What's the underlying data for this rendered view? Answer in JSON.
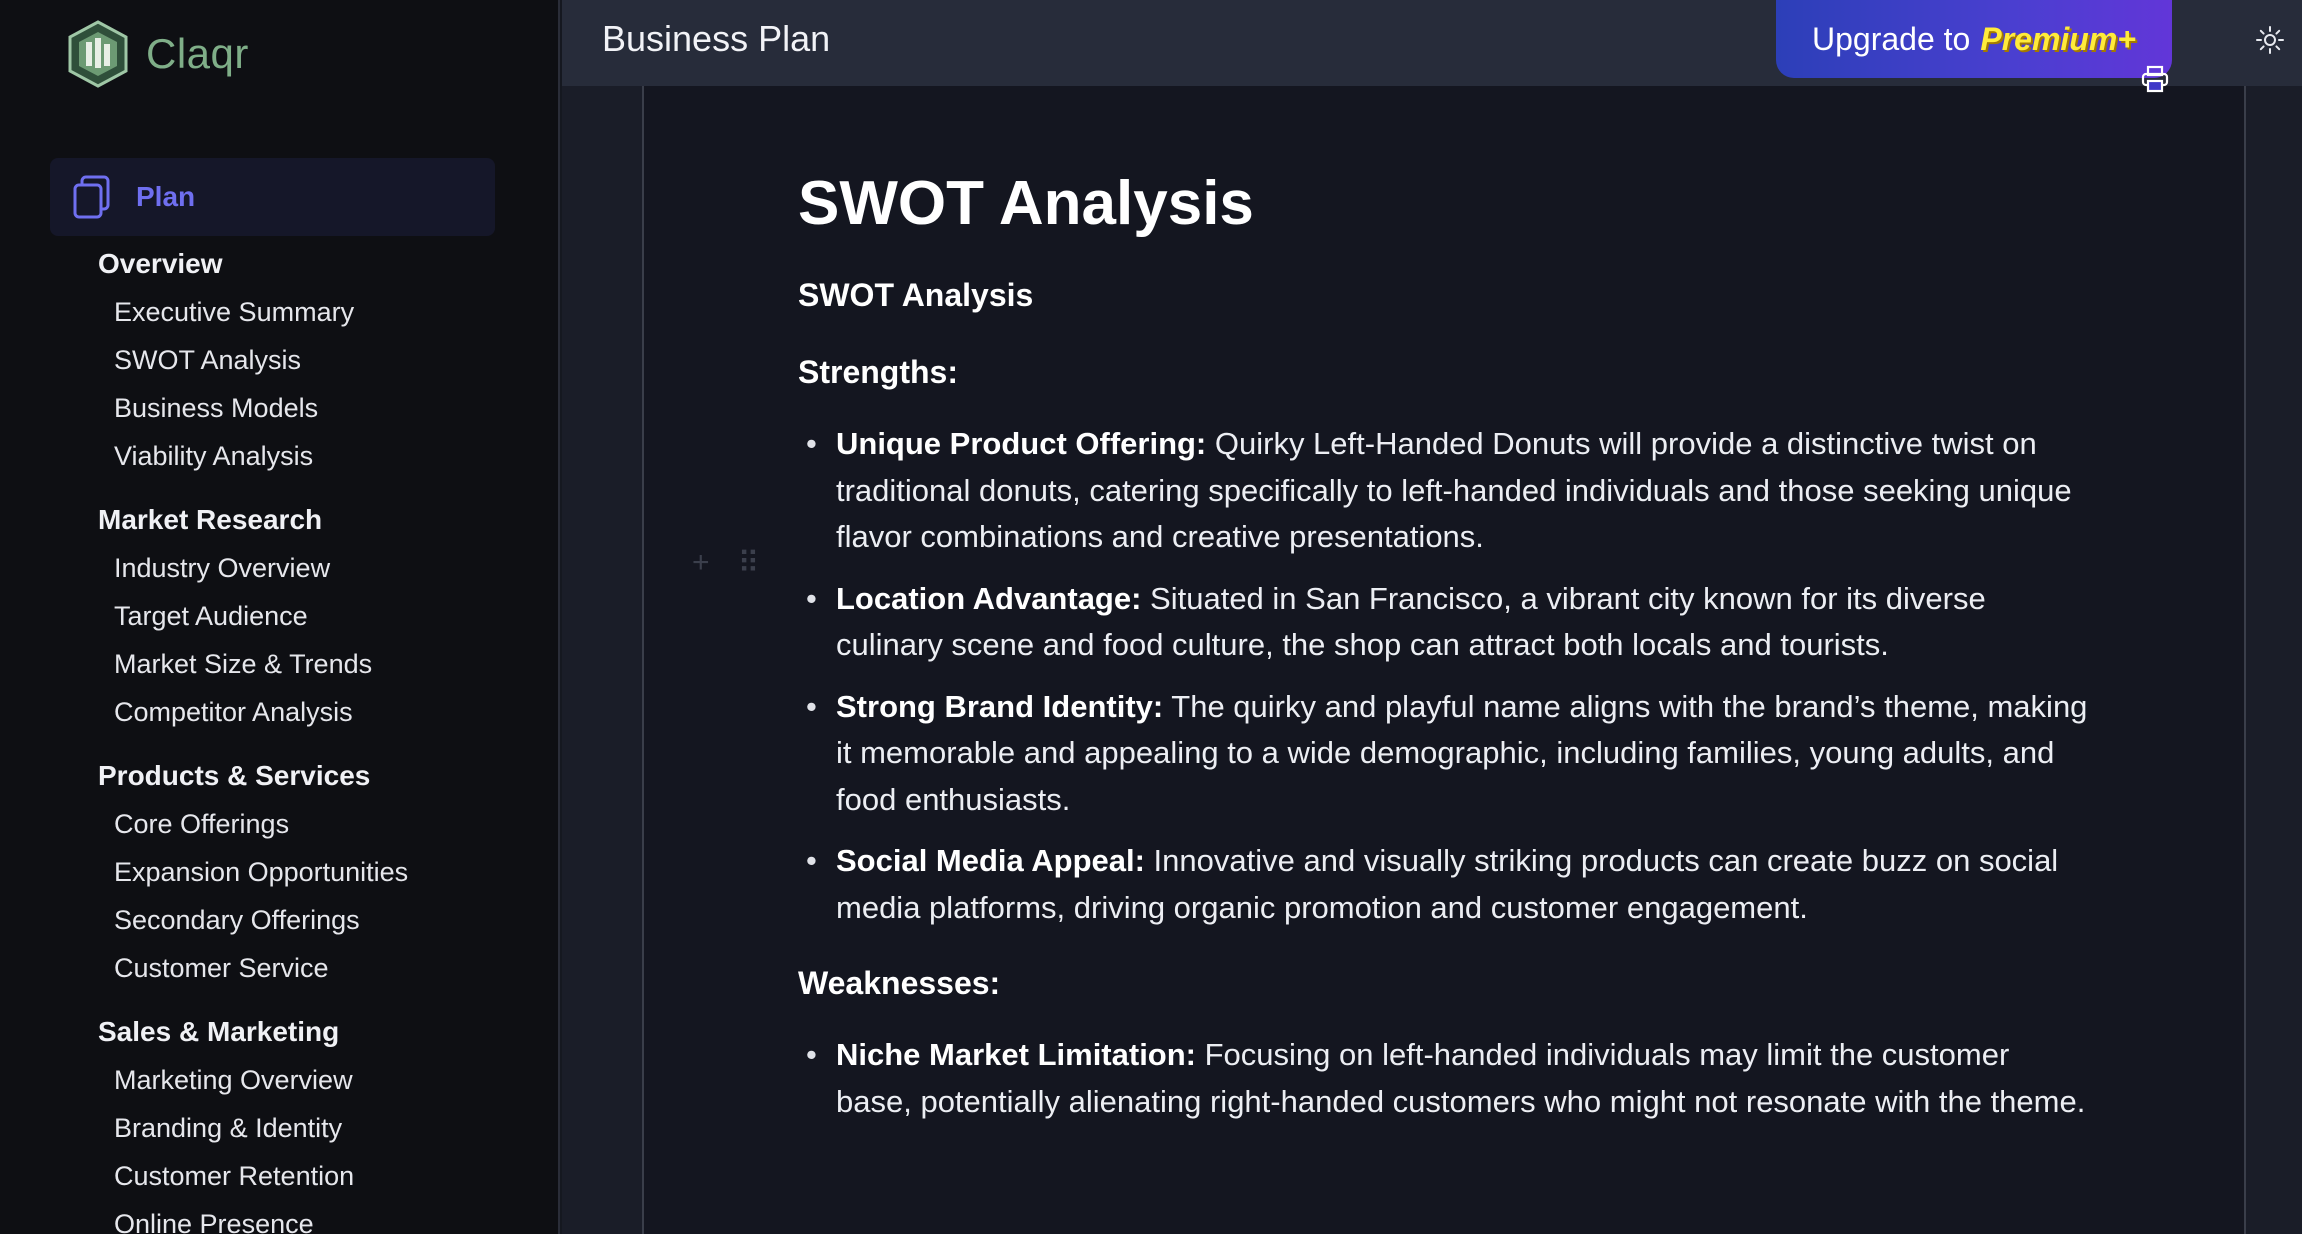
{
  "app": {
    "name": "Claqr"
  },
  "sidebar": {
    "plan_label": "Plan",
    "sections": [
      {
        "title": "Overview",
        "items": [
          "Executive Summary",
          "SWOT Analysis",
          "Business Models",
          "Viability Analysis"
        ]
      },
      {
        "title": "Market Research",
        "items": [
          "Industry Overview",
          "Target Audience",
          "Market Size & Trends",
          "Competitor Analysis"
        ]
      },
      {
        "title": "Products & Services",
        "items": [
          "Core Offerings",
          "Expansion Opportunities",
          "Secondary Offerings",
          "Customer Service"
        ]
      },
      {
        "title": "Sales & Marketing",
        "items": [
          "Marketing Overview",
          "Branding & Identity",
          "Customer Retention",
          "Online Presence"
        ]
      }
    ]
  },
  "header": {
    "title": "Business Plan",
    "upgrade_prefix": "Upgrade to",
    "upgrade_highlight": "Premium+"
  },
  "doc": {
    "h1": "SWOT Analysis",
    "h2": "SWOT Analysis",
    "strengths_title": "Strengths:",
    "strengths": [
      {
        "term": "Unique Product Offering:",
        "text": " Quirky Left-Handed Donuts will provide a distinctive twist on traditional donuts, catering specifically to left-handed individuals and those seeking unique flavor combinations and creative presentations."
      },
      {
        "term": "Location Advantage:",
        "text": " Situated in San Francisco, a vibrant city known for its diverse culinary scene and food culture, the shop can attract both locals and tourists."
      },
      {
        "term": "Strong Brand Identity:",
        "text": " The quirky and playful name aligns with the brand’s theme, making it memorable and appealing to a wide demographic, including families, young adults, and food enthusiasts."
      },
      {
        "term": "Social Media Appeal:",
        "text": " Innovative and visually striking products can create buzz on social media platforms, driving organic promotion and customer engagement."
      }
    ],
    "weaknesses_title": "Weaknesses:",
    "weaknesses": [
      {
        "term": "Niche Market Limitation:",
        "text": " Focusing on left-handed individuals may limit the customer base, potentially alienating right-handed customers who might not resonate with the theme."
      }
    ]
  },
  "colors": {
    "accent": "#6f6ff0",
    "logo": "#7fae88",
    "premium": "#ffeb3b"
  }
}
